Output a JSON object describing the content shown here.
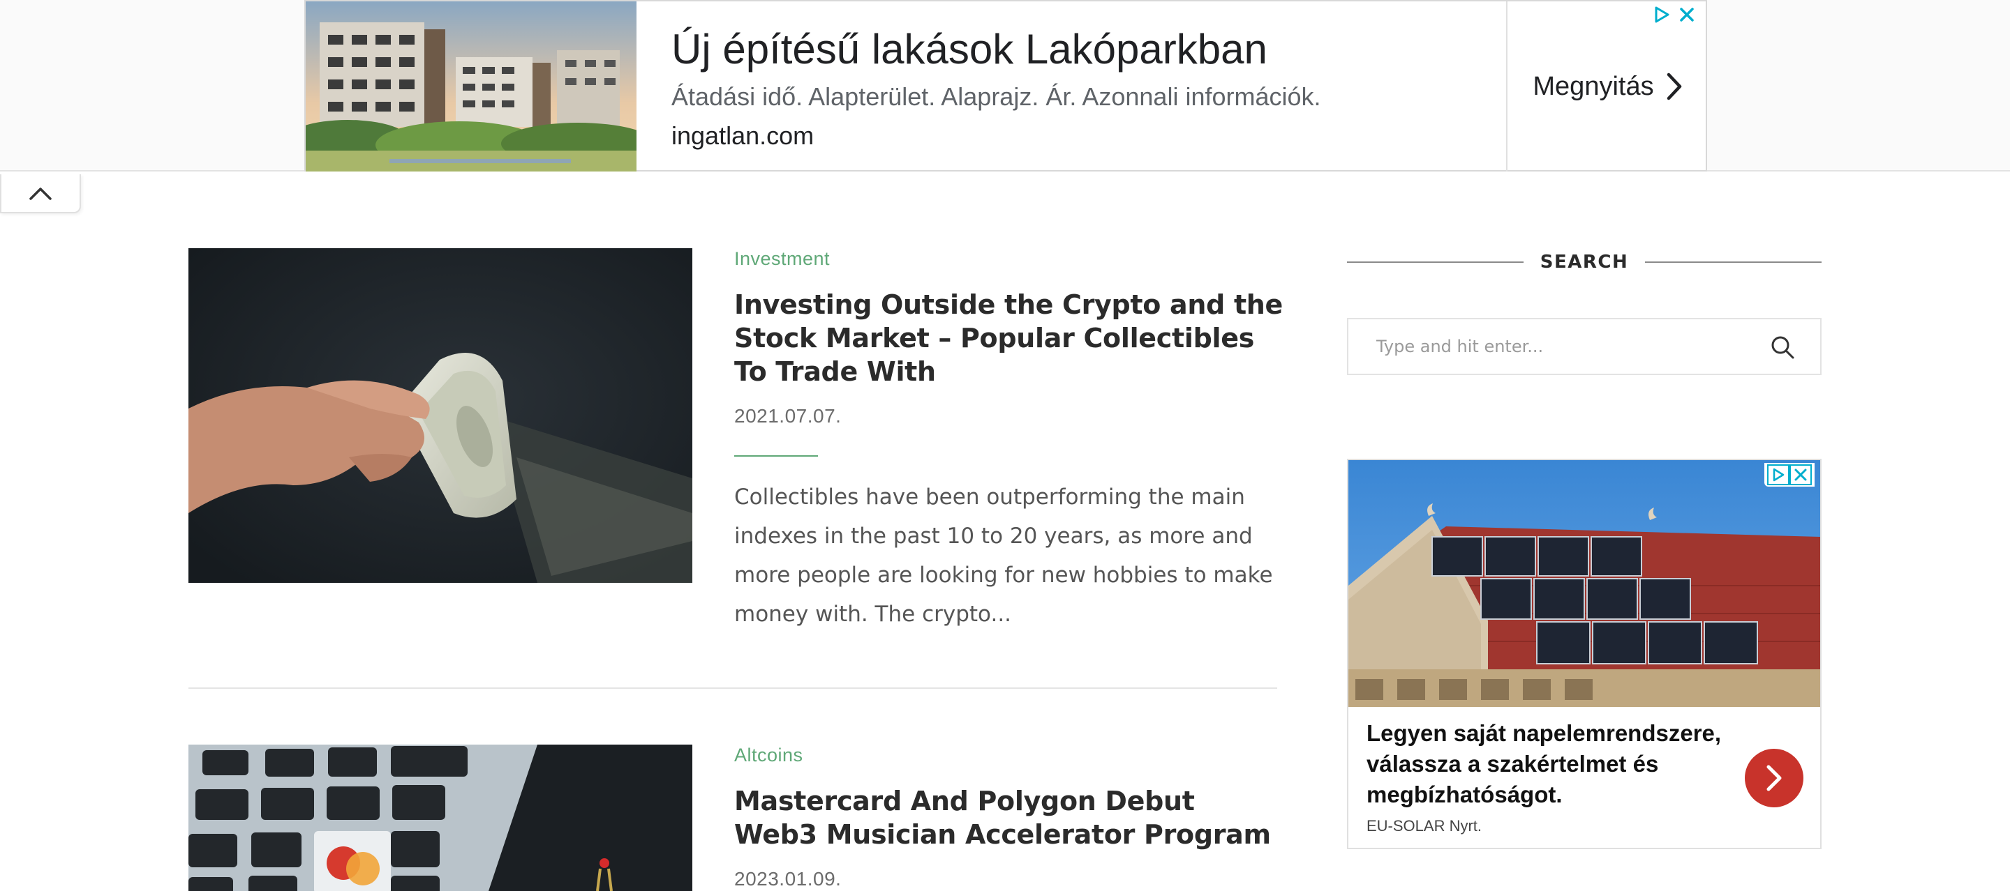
{
  "top_ad": {
    "title": "Új építésű lakások Lakóparkban",
    "description": "Átadási idő. Alapterület. Alaprajz. Ár. Azonnali információk.",
    "url": "ingatlan.com",
    "cta": "Megnyitás",
    "icons": [
      "adchoices-icon",
      "close-icon",
      "chevron-right-icon",
      "chevron-up-icon"
    ]
  },
  "posts": [
    {
      "category": "Investment",
      "title": "Investing Outside the Crypto and the Stock Market – Popular Collectibles To Trade With",
      "date": "2021.07.07.",
      "excerpt": "Collectibles have been outperforming the main indexes in the past 10 to 20 years, as more and more people are looking for new hobbies to make money with. The crypto..."
    },
    {
      "category": "Altcoins",
      "title": "Mastercard And Polygon Debut Web3 Musician Accelerator Program",
      "date": "2023.01.09."
    }
  ],
  "sidebar": {
    "search_heading": "SEARCH",
    "search_placeholder": "Type and hit enter...",
    "ad": {
      "title": "Legyen saját napelemrendszere, válassza a szakértelmet és megbízhatóságot.",
      "brand": "EU-SOLAR Nyrt."
    }
  },
  "colors": {
    "accent_green": "#5fa877",
    "ad_button_red": "#c8332b",
    "adchoices_blue": "#00aecd"
  }
}
